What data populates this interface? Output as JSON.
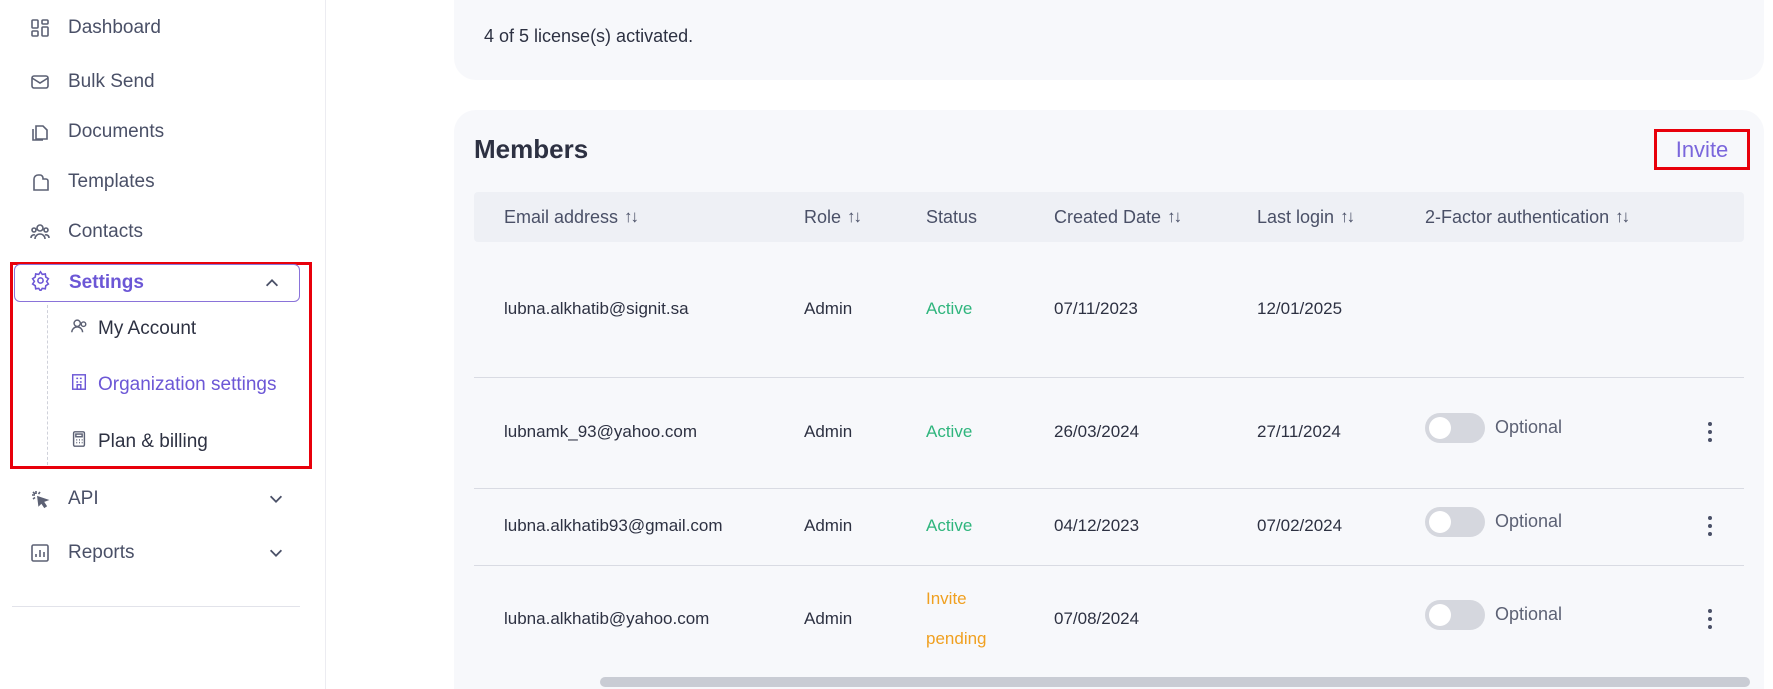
{
  "sidebar": {
    "items": [
      {
        "label": "Dashboard",
        "icon": "dashboard-icon"
      },
      {
        "label": "Bulk Send",
        "icon": "envelope-icon"
      },
      {
        "label": "Documents",
        "icon": "documents-icon"
      },
      {
        "label": "Templates",
        "icon": "templates-icon"
      },
      {
        "label": "Contacts",
        "icon": "contacts-icon"
      }
    ],
    "settings": {
      "label": "Settings",
      "icon": "gear-icon",
      "expanded": true,
      "children": [
        {
          "label": "My Account",
          "icon": "user-icon"
        },
        {
          "label": "Organization settings",
          "icon": "building-icon",
          "active": true
        },
        {
          "label": "Plan & billing",
          "icon": "calculator-icon"
        }
      ]
    },
    "bottom_items": [
      {
        "label": "API",
        "icon": "cursor-click-icon"
      },
      {
        "label": "Reports",
        "icon": "chart-icon"
      }
    ]
  },
  "license": {
    "text": "4 of 5 license(s) activated."
  },
  "members": {
    "title": "Members",
    "invite_label": "Invite",
    "columns": [
      "Email address",
      "Role",
      "Status",
      "Created Date",
      "Last login",
      "2-Factor authentication"
    ],
    "sort_glyph": "↑↓",
    "rows": [
      {
        "email": "lubna.alkhatib@signit.sa",
        "role": "Admin",
        "status": "Active",
        "created": "07/11/2023",
        "last_login": "12/01/2025"
      },
      {
        "email": "lubnamk_93@yahoo.com",
        "role": "Admin",
        "status": "Active",
        "created": "26/03/2024",
        "last_login": "27/11/2024",
        "two_factor": "Optional"
      },
      {
        "email": "lubna.alkhatib93@gmail.com",
        "role": "Admin",
        "status": "Active",
        "created": "04/12/2023",
        "last_login": "07/02/2024",
        "two_factor": "Optional"
      },
      {
        "email": "lubna.alkhatib@yahoo.com",
        "role": "Admin",
        "status_line1": "Invite",
        "status_line2": "pending",
        "created": "07/08/2024",
        "two_factor": "Optional"
      }
    ]
  },
  "colors": {
    "accent": "#6c57d6",
    "active": "#2fb57d",
    "pending": "#f0a020",
    "highlight": "#e8000b"
  }
}
